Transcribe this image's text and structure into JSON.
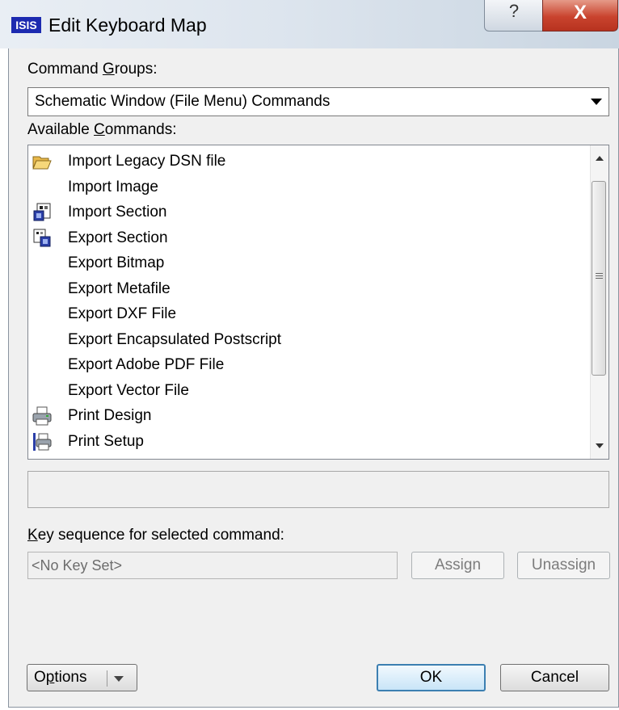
{
  "window": {
    "app_icon_text": "ISIS",
    "title": "Edit Keyboard Map",
    "help_button": "?",
    "close_button": "X"
  },
  "command_groups": {
    "label": "Command Groups:",
    "selected": "Schematic Window (File Menu) Commands"
  },
  "available_commands": {
    "label": "Available Commands:",
    "items": [
      {
        "label": "Import Legacy DSN file",
        "icon": "folder-open-icon"
      },
      {
        "label": "Import Image",
        "icon": ""
      },
      {
        "label": "Import Section",
        "icon": "import-section-icon"
      },
      {
        "label": "Export Section",
        "icon": "export-section-icon"
      },
      {
        "label": "Export Bitmap",
        "icon": ""
      },
      {
        "label": "Export Metafile",
        "icon": ""
      },
      {
        "label": "Export DXF File",
        "icon": ""
      },
      {
        "label": "Export Encapsulated Postscript",
        "icon": ""
      },
      {
        "label": "Export Adobe PDF File",
        "icon": ""
      },
      {
        "label": "Export Vector File",
        "icon": ""
      },
      {
        "label": "Print Design",
        "icon": "printer-icon"
      },
      {
        "label": "Print Setup",
        "icon": "print-setup-icon"
      }
    ]
  },
  "key_sequence": {
    "label": "Key sequence for selected command:",
    "value": "<No Key Set>",
    "assign": "Assign",
    "unassign": "Unassign"
  },
  "footer": {
    "options": "Options",
    "ok": "OK",
    "cancel": "Cancel"
  },
  "colors": {
    "accent": "#3c7fb1",
    "close_button": "#c9432e",
    "app_icon": "#1c2ab0"
  }
}
